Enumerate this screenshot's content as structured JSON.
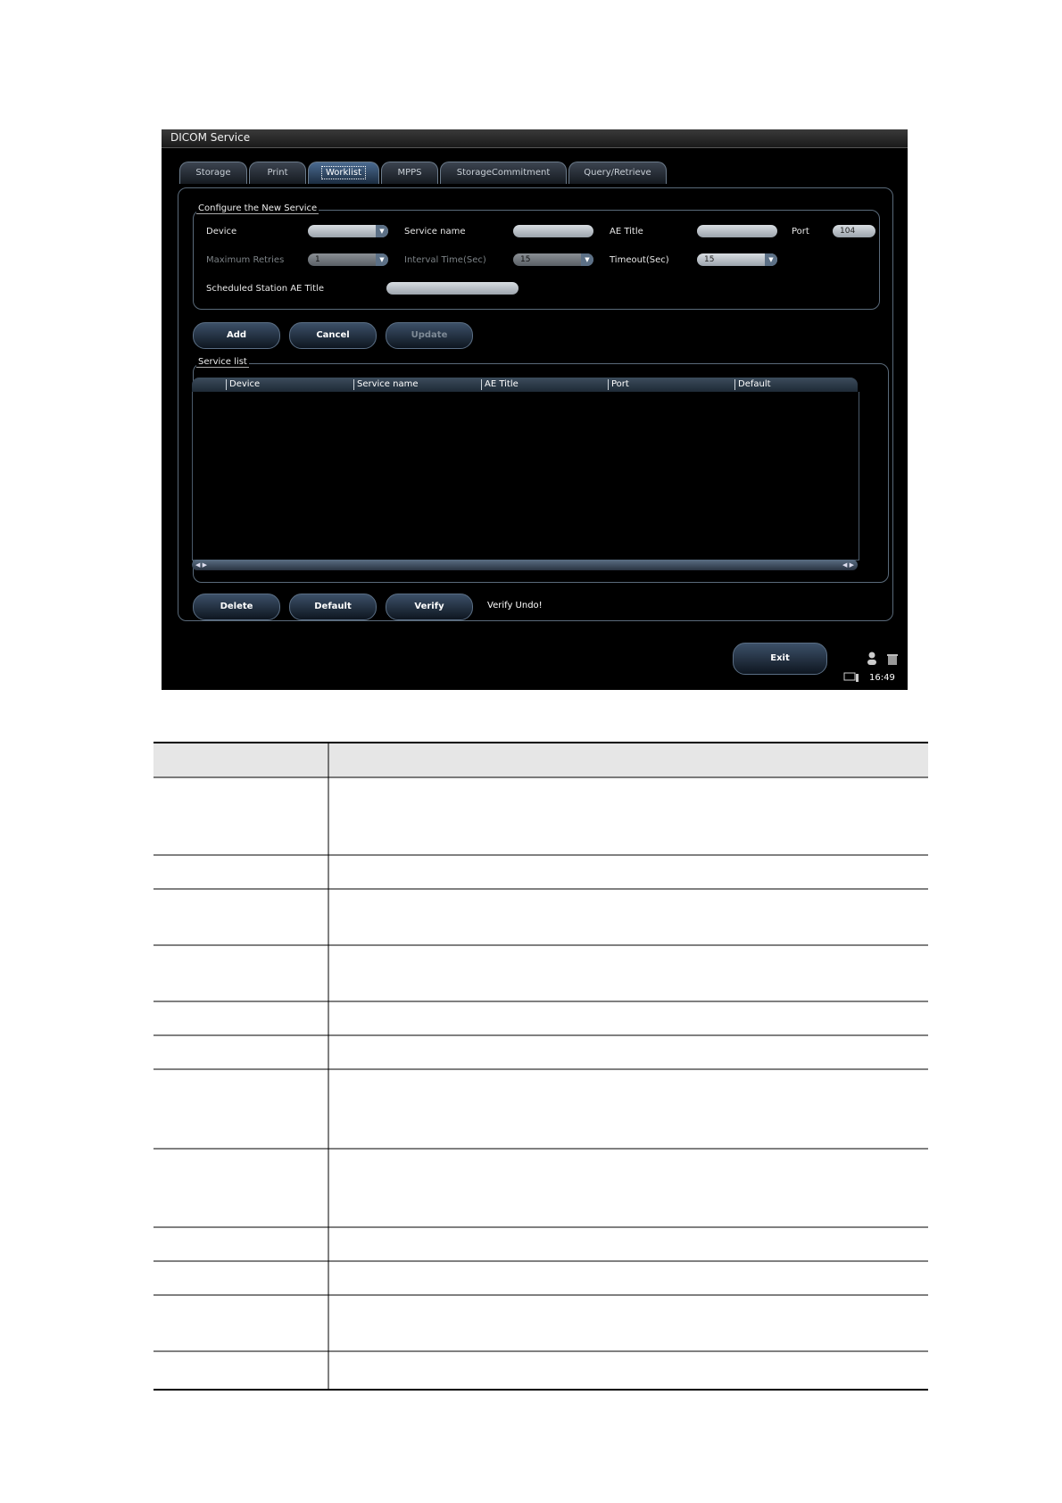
{
  "window": {
    "title": "DICOM Service"
  },
  "tabs": [
    "Storage",
    "Print",
    "Worklist",
    "MPPS",
    "StorageCommitment",
    "Query/Retrieve"
  ],
  "active_tab": "Worklist",
  "config": {
    "group_label": "Configure the New Service",
    "device_label": "Device",
    "device_value": "",
    "service_name_label": "Service name",
    "service_name_value": "",
    "ae_title_label": "AE Title",
    "ae_title_value": "",
    "port_label": "Port",
    "port_value": "104",
    "max_retries_label": "Maximum Retries",
    "max_retries_value": "1",
    "interval_label": "Interval Time(Sec)",
    "interval_value": "15",
    "timeout_label": "Timeout(Sec)",
    "timeout_value": "15",
    "scheduled_label": "Scheduled Station AE Title",
    "scheduled_value": ""
  },
  "actions": {
    "add": "Add",
    "cancel": "Cancel",
    "update": "Update"
  },
  "service_list": {
    "label": "Service list",
    "columns": [
      "Device",
      "Service name",
      "AE Title",
      "Port",
      "Default"
    ]
  },
  "bottom_actions": {
    "delete": "Delete",
    "default": "Default",
    "verify": "Verify",
    "status": "Verify Undo!"
  },
  "footer": {
    "exit": "Exit",
    "clock": "16:49"
  },
  "table": {
    "rows": 12
  }
}
